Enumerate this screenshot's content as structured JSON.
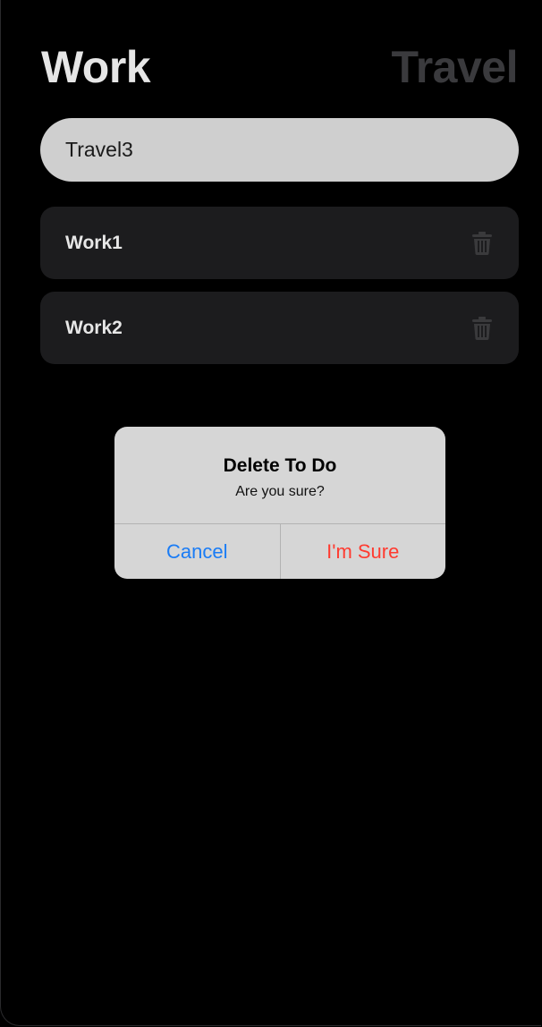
{
  "header": {
    "tabs": [
      {
        "label": "Work",
        "active": true
      },
      {
        "label": "Travel",
        "active": false
      }
    ]
  },
  "input": {
    "value": "Travel3"
  },
  "todos": [
    {
      "label": "Work1",
      "icon": "trash-icon"
    },
    {
      "label": "Work2",
      "icon": "trash-icon"
    }
  ],
  "dialog": {
    "title": "Delete To Do",
    "message": "Are you sure?",
    "cancel_label": "Cancel",
    "confirm_label": "I'm Sure"
  },
  "colors": {
    "background": "#000000",
    "tab_active": "#e6e6e6",
    "tab_inactive": "#3a3a3d",
    "item_background": "#1c1c1e",
    "cancel": "#1a7cf5",
    "destructive": "#ff3b30"
  }
}
